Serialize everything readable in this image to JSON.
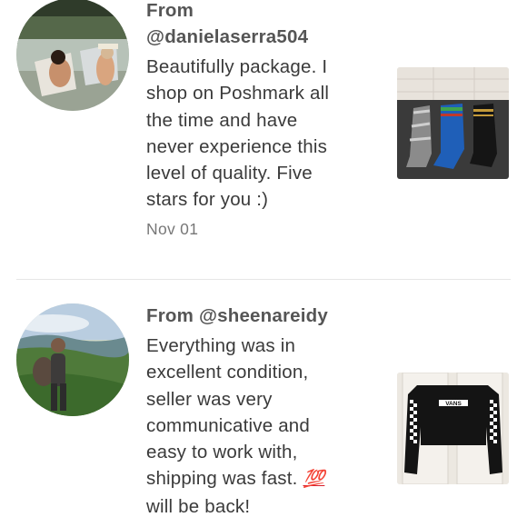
{
  "reviews": [
    {
      "from_label": "From",
      "username": "@danielaserra504",
      "text": "Beautifully package. I\nshop on Poshmark all\nthe time and have\nnever experience this\nlevel of quality. Five\nstars for you :)",
      "date": "Nov 01",
      "avatar_icon": "beach-loungers-photo",
      "thumb_icon": "socks-photo"
    },
    {
      "from_line": "From @sheenareidy",
      "text": "Everything was in\nexcellent condition,\nseller was very\ncommunicative and\neasy to work with,\nshipping was fast.",
      "emoji": "💯",
      "text_end": "will be back!",
      "avatar_icon": "hiker-mountain-photo",
      "thumb_icon": "vans-shirt-photo",
      "shirt_logo": "VANS"
    }
  ],
  "colors": {
    "accent_emoji": "#d81e2a",
    "divider": "#e6e6e6"
  }
}
